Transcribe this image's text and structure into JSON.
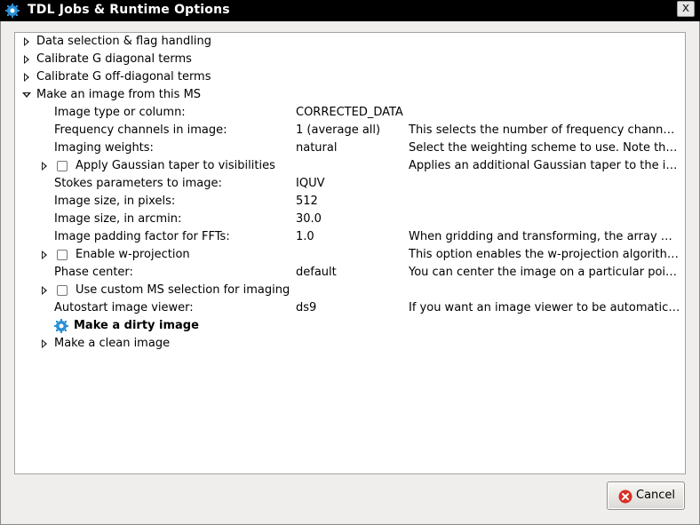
{
  "window": {
    "title": "TDL Jobs & Runtime Options",
    "close_glyph": "x",
    "app_icon": "gear-icon"
  },
  "tree": {
    "top_items": [
      "Data selection & flag handling",
      "Calibrate G diagonal terms",
      "Calibrate G off-diagonal terms",
      "Make an image from this MS"
    ],
    "options": [
      {
        "label": "Image type or column:",
        "value": "CORRECTED_DATA",
        "desc": ""
      },
      {
        "label": "Frequency channels in image:",
        "value": "1 (average all)",
        "desc": "This selects the number of frequency channels to image..."
      },
      {
        "label": "Imaging weights:",
        "value": "natural",
        "desc": "Select the weighting scheme to use. Note that..."
      },
      {
        "label": "Apply Gaussian taper to visibilities",
        "value": "",
        "desc": "Applies an additional Gaussian taper to the imaging..."
      },
      {
        "label": "Stokes parameters to image:",
        "value": "IQUV",
        "desc": ""
      },
      {
        "label": "Image size, in pixels:",
        "value": "512",
        "desc": ""
      },
      {
        "label": "Image size, in arcmin:",
        "value": "30.0",
        "desc": ""
      },
      {
        "label": "Image padding factor for FFTs:",
        "value": "1.0",
        "desc": "When gridding and transforming, the array may be padded..."
      },
      {
        "label": "Enable w-projection",
        "value": "",
        "desc": "This option enables the w-projection algorithm..."
      },
      {
        "label": "Phase center:",
        "value": "default",
        "desc": "You can center the image on a particular point..."
      },
      {
        "label": "Use custom MS selection for imaging",
        "value": "",
        "desc": ""
      },
      {
        "label": "Autostart image viewer:",
        "value": "ds9",
        "desc": "If you want an image viewer to be automatically started..."
      }
    ],
    "job_dirty": "Make a dirty image",
    "job_clean": "Make a clean image"
  },
  "buttons": {
    "cancel": "Cancel"
  },
  "colors": {
    "titlebar_bg": "#000000",
    "gear_blue": "#2a8fd6",
    "cancel_red": "#d93025"
  }
}
